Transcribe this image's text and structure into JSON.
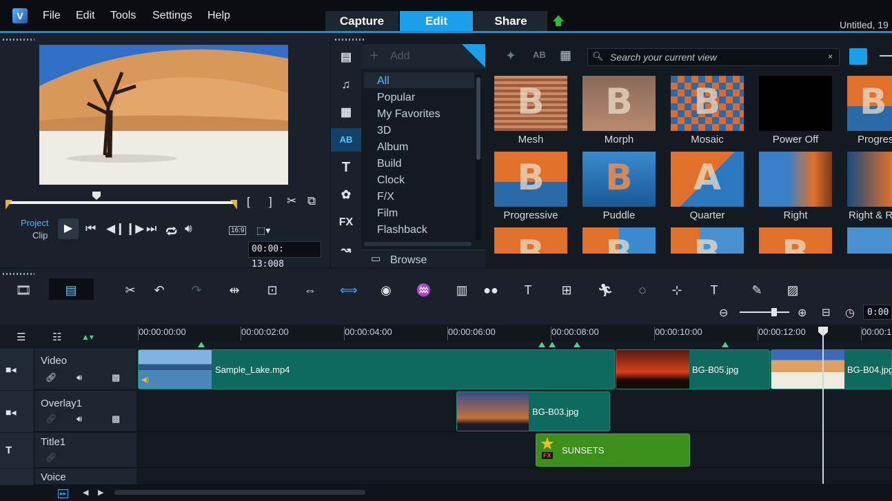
{
  "menu": {
    "file": "File",
    "edit": "Edit",
    "tools": "Tools",
    "settings": "Settings",
    "help": "Help"
  },
  "modes": {
    "capture": "Capture",
    "edit": "Edit",
    "share": "Share"
  },
  "project_title": "Untitled, 19",
  "player": {
    "mode_project": "Project",
    "mode_clip": "Clip",
    "aspect": "16:9",
    "timecode": "00:00: 13:008"
  },
  "library": {
    "add_label": "Add",
    "search_placeholder": "Search your current view",
    "browse_label": "Browse",
    "categories": [
      "All",
      "Popular",
      "My Favorites",
      "3D",
      "Album",
      "Build",
      "Clock",
      "F/X",
      "Film",
      "Flashback"
    ],
    "transitions": [
      {
        "label": "Mesh"
      },
      {
        "label": "Morph"
      },
      {
        "label": "Mosaic"
      },
      {
        "label": "Power Off"
      },
      {
        "label": "Progres"
      },
      {
        "label": "Progressive"
      },
      {
        "label": "Puddle"
      },
      {
        "label": "Quarter"
      },
      {
        "label": "Right"
      },
      {
        "label": "Right & R"
      }
    ]
  },
  "timeline": {
    "zoom_readout": "0:00",
    "ruler": [
      "00:00:00:00",
      "00:00:02:00",
      "00:00:04:00",
      "00:00:06:00",
      "00:00:08:00",
      "00:00:10:00",
      "00:00:12:00",
      "00:00:1"
    ],
    "tracks": [
      {
        "name": "Video"
      },
      {
        "name": "Overlay1"
      },
      {
        "name": "Title1"
      },
      {
        "name": "Voice"
      }
    ],
    "clips": {
      "video1": "Sample_Lake.mp4",
      "video2": "BG-B05.jpg",
      "video3": "BG-B04.jpg",
      "overlay1": "BG-B03.jpg",
      "title1": "SUNSETS",
      "title_fx": "FX"
    }
  },
  "colors": {
    "accent": "#1aa0e8",
    "clip_green": "#0e6a5c",
    "title_clip": "#3b8f1a"
  }
}
